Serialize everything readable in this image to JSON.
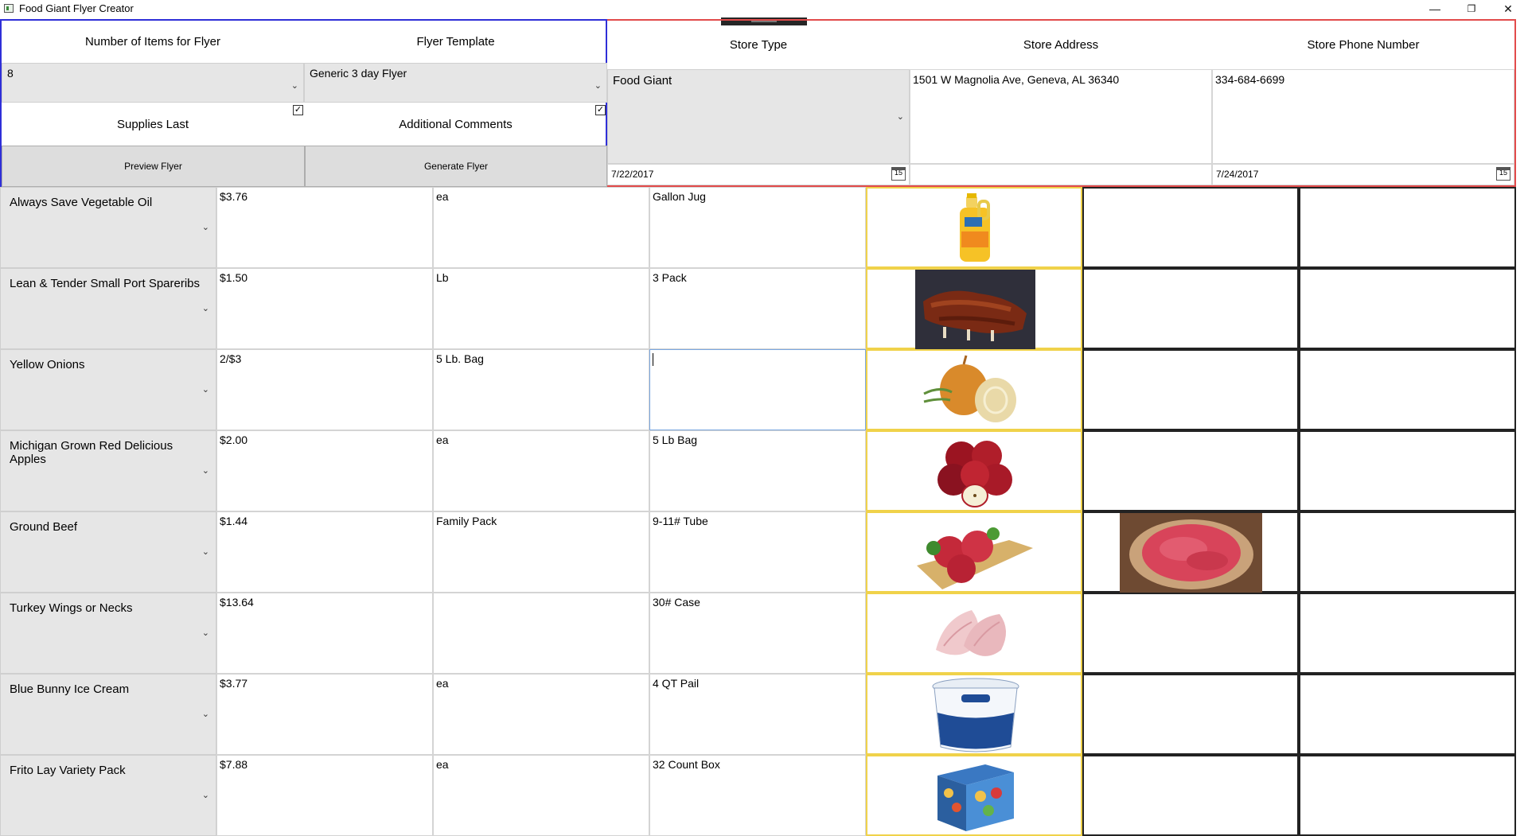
{
  "window": {
    "title": "Food Giant Flyer Creator",
    "minimize": "—",
    "restore": "❐",
    "close": "✕"
  },
  "left_panel": {
    "items_label": "Number of Items for Flyer",
    "template_label": "Flyer Template",
    "items_value": "8",
    "template_value": "Generic 3 day Flyer",
    "supplies_label": "Supplies Last",
    "comments_label": "Additional Comments",
    "preview_button": "Preview Flyer",
    "generate_button": "Generate Flyer"
  },
  "right_panel": {
    "store_type_label": "Store Type",
    "store_address_label": "Store Address",
    "store_phone_label": "Store Phone Number",
    "store_type_value": "Food Giant",
    "store_address_value": "1501 W Magnolia Ave, Geneva, AL 36340",
    "store_phone_value": "334-684-6699",
    "start_date": "7/22/2017",
    "end_date": "7/24/2017",
    "calendar_glyph": "15"
  },
  "rows": [
    {
      "name": "Always Save Vegetable Oil",
      "price": "$3.76",
      "unit": "ea",
      "size": "Gallon Jug",
      "image": "vegetable-oil-jug"
    },
    {
      "name": "Lean & Tender Small Port Spareribs",
      "price": "$1.50",
      "unit": "Lb",
      "size": "3 Pack",
      "image": "spareribs"
    },
    {
      "name": "Yellow Onions",
      "price": "2/$3",
      "unit": "5 Lb. Bag",
      "size": "",
      "image": "yellow-onions"
    },
    {
      "name": "Michigan Grown Red Delicious Apples",
      "price": "$2.00",
      "unit": "ea",
      "size": "5 Lb Bag",
      "image": "red-apples"
    },
    {
      "name": "Ground Beef",
      "price": "$1.44",
      "unit": "Family Pack",
      "size": "9-11# Tube",
      "image": "ground-beef-patties"
    },
    {
      "name": "Turkey Wings or Necks",
      "price": "$13.64",
      "unit": "",
      "size": "30# Case",
      "image": "turkey-wings"
    },
    {
      "name": "Blue Bunny Ice Cream",
      "price": "$3.77",
      "unit": "ea",
      "size": "4 QT Pail",
      "image": "ice-cream-pail"
    },
    {
      "name": "Frito Lay Variety Pack",
      "price": "$7.88",
      "unit": "ea",
      "size": "32 Count Box",
      "image": "chips-variety-box"
    }
  ],
  "colors": {
    "left_border": "#2f2fd8",
    "right_border": "#e24b4b",
    "image_border": "#f0d24a",
    "extra_border": "#222222",
    "combo_bg": "#e6e6e6"
  }
}
